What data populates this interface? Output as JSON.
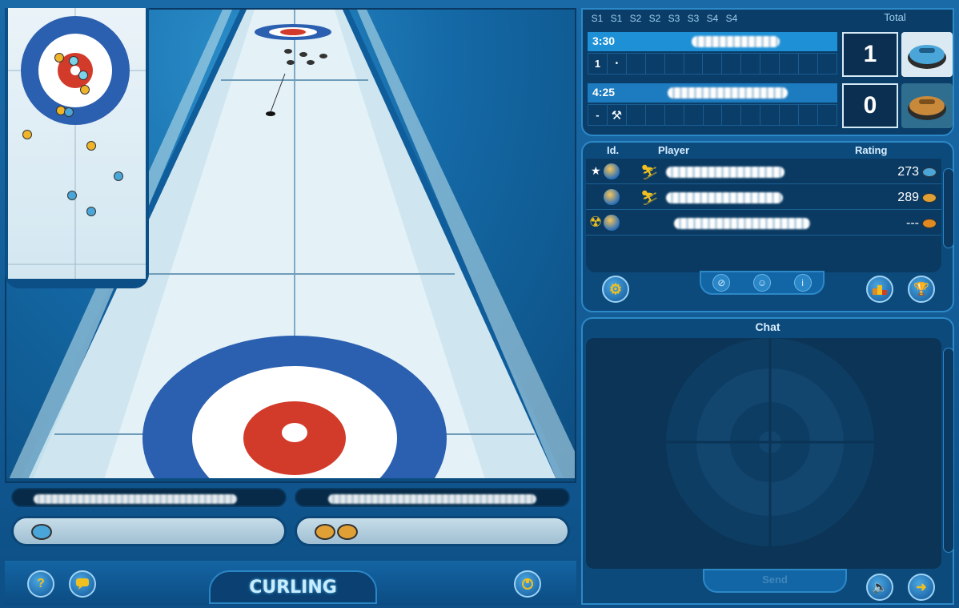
{
  "game": {
    "logo": "CURLING"
  },
  "scoreboard": {
    "ends": [
      "S1",
      "S1",
      "S2",
      "S2",
      "S3",
      "S3",
      "S4",
      "S4"
    ],
    "total_label": "Total",
    "teams": [
      {
        "time": "3:30",
        "end1": "1",
        "end2": "•",
        "total": "1",
        "stone": "#4aa6d8"
      },
      {
        "time": "4:25",
        "end1": "-",
        "hammer": "⚒",
        "total": "0",
        "stone": "#c88a3a"
      }
    ]
  },
  "players": {
    "headers": {
      "id": "Id.",
      "player": "Player",
      "rating": "Rating"
    },
    "rows": [
      {
        "rating": "273",
        "stone": "#4aa6d8"
      },
      {
        "rating": "289",
        "stone": "#e0a035"
      },
      {
        "rating": "---",
        "stone": "#e08a20"
      }
    ]
  },
  "chat": {
    "title": "Chat",
    "send_label": "Send"
  },
  "buttons": {
    "help": "?"
  },
  "icons": {
    "help": "help-icon",
    "chat": "speech-icon",
    "settings": "gear-icon",
    "sound": "speaker-icon",
    "exit": "exit-icon",
    "trophy": "trophy-icon",
    "podium": "podium-icon",
    "options": "options-icon"
  }
}
